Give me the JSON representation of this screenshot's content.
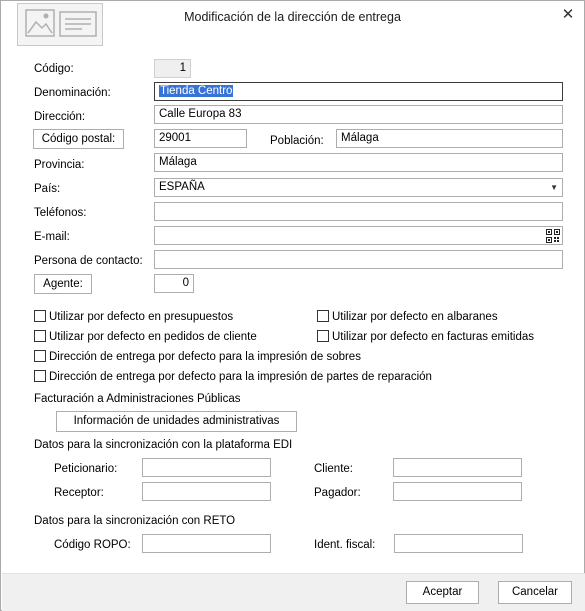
{
  "window": {
    "title": "Modificación de la dirección de entrega"
  },
  "labels": {
    "codigo": "Código:",
    "denominacion": "Denominación:",
    "direccion": "Dirección:",
    "poblacion": "Población:",
    "provincia": "Provincia:",
    "pais": "País:",
    "telefonos": "Teléfonos:",
    "email": "E-mail:",
    "contacto": "Persona de contacto:",
    "facturacion": "Facturación a Administraciones Públicas",
    "edi_title": "Datos para la sincronización con la plataforma EDI",
    "peticionario": "Peticionario:",
    "cliente": "Cliente:",
    "receptor": "Receptor:",
    "pagador": "Pagador:",
    "reto_title": "Datos para la sincronización con RETO",
    "codigo_ropo": "Código ROPO:",
    "ident_fiscal": "Ident. fiscal:"
  },
  "values": {
    "codigo": "1",
    "denominacion": "Tienda Centro",
    "direccion": "Calle Europa 83",
    "codigo_postal": "29001",
    "poblacion": "Málaga",
    "provincia": "Málaga",
    "pais": "ESPAÑA",
    "telefonos": "",
    "email": "",
    "contacto": "",
    "agente": "0",
    "peticionario": "",
    "cliente": "",
    "receptor": "",
    "pagador": "",
    "codigo_ropo": "",
    "ident_fiscal": ""
  },
  "buttons": {
    "codigo_postal": "Código postal:",
    "agente": "Agente:",
    "info_unidades": "Información de unidades administrativas",
    "aceptar": "Aceptar",
    "cancelar": "Cancelar"
  },
  "checkboxes": {
    "presupuestos": "Utilizar por defecto en presupuestos",
    "albaranes": "Utilizar por defecto en albaranes",
    "pedidos": "Utilizar por defecto en pedidos de cliente",
    "facturas": "Utilizar por defecto en facturas emitidas",
    "sobres": "Dirección de entrega por defecto para la impresión de sobres",
    "partes": "Dirección de entrega por defecto para la impresión de partes de reparación"
  },
  "icons": {
    "close": "close-icon",
    "dropdown": "chevron-down-icon",
    "qr": "qr-code-icon",
    "logo": "image-placeholder-icon"
  },
  "colors": {
    "selection": "#3874d8",
    "footer": "#f0f0f0"
  }
}
